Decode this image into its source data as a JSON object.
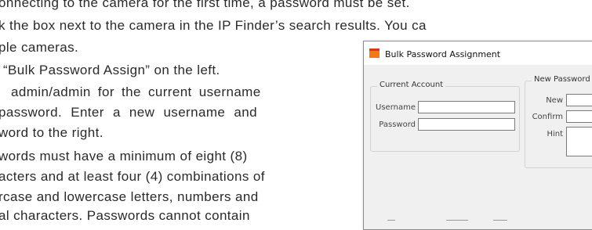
{
  "document": {
    "lines": [
      "onnecting to the camera for the first time, a password must be set.",
      "k the box next to the camera in the IP Finder’s search results. You ca",
      "ple cameras.",
      "“Bulk Password Assign” on the left.",
      "admin/admin for the current username",
      "password. Enter a new username and",
      "word to the right.",
      "words must have a minimum of eight (8)",
      "acters and at least four (4) combinations of",
      "rcase and lowercase letters, numbers and",
      "al characters. Passwords cannot contain"
    ]
  },
  "dialog": {
    "title": "Bulk Password Assignment",
    "current_account": {
      "legend": "Current Account",
      "username_label": "Username",
      "password_label": "Password"
    },
    "new_password": {
      "legend": "New Password",
      "new_label": "New",
      "confirm_label": "Confirm",
      "hint_label": "Hint"
    }
  },
  "colors": {
    "app_icon": "#f07a1a",
    "dialog_body": "#f0f0f0"
  }
}
